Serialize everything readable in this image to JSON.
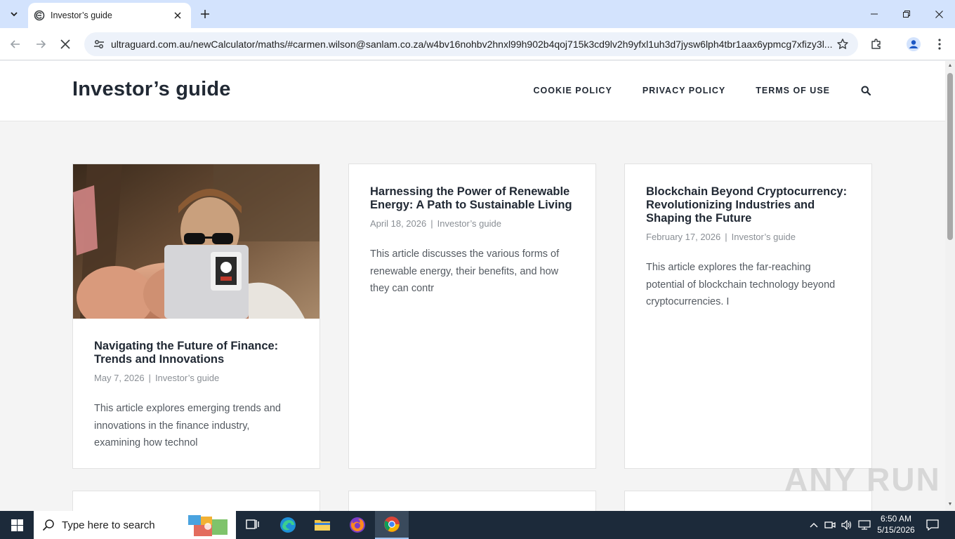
{
  "browser": {
    "tab_title": "Investor’s guide",
    "url_host": "ultraguard.com.au",
    "url_path": "/newCalculator/maths/#carmen.wilson@sanlam.co.za/w4bv16nohbv2hnxl99h902b4qoj715k3cd9lv2h9yfxl1uh3d7jysw6lph4tbr1aax6ypmcg7xfizy3l..."
  },
  "site": {
    "title": "Investor’s guide",
    "nav": [
      "COOKIE POLICY",
      "PRIVACY POLICY",
      "TERMS OF USE"
    ]
  },
  "posts": [
    {
      "title": "Navigating the Future of Finance: Trends and Innovations",
      "date": "May 7, 2026",
      "category": "Investor’s guide",
      "excerpt": "This article explores emerging trends and innovations in the finance industry, examining how technol"
    },
    {
      "title": "Harnessing the Power of Renewable Energy: A Path to Sustainable Living",
      "date": "April 18, 2026",
      "category": "Investor’s guide",
      "excerpt": "This article discusses the various forms of renewable energy, their benefits, and how they can contr"
    },
    {
      "title": "Blockchain Beyond Cryptocurrency: Revolutionizing Industries and Shaping the Future",
      "date": "February 17, 2026",
      "category": "Investor’s guide",
      "excerpt": "This article explores the far-reaching potential of blockchain technology beyond cryptocurrencies. I"
    }
  ],
  "meta_separator": "|",
  "watermark": "ANY RUN",
  "taskbar": {
    "search_placeholder": "Type here to search",
    "time": "6:50 AM",
    "date": "5/15/2026"
  },
  "colors": {
    "tabbar": "#d3e3fd",
    "heading": "#212934",
    "meta": "#8a8f95",
    "taskbar": "#1c2a3a"
  }
}
